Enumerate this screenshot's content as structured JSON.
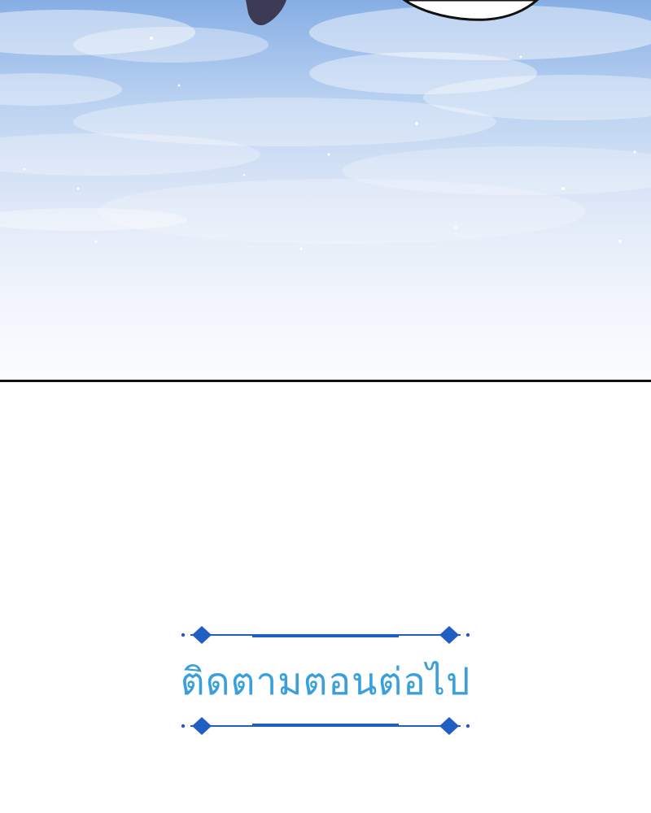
{
  "next_episode": {
    "label": "ติดตามตอนต่อไป"
  },
  "colors": {
    "sky_top": "#86aee4",
    "sky_bottom": "#fbfcff",
    "text_blue": "#3aa0db",
    "ornament_blue": "#1f5fc4",
    "panel_border": "#111111"
  },
  "icons": {
    "ornament": "diamond-divider-icon"
  }
}
